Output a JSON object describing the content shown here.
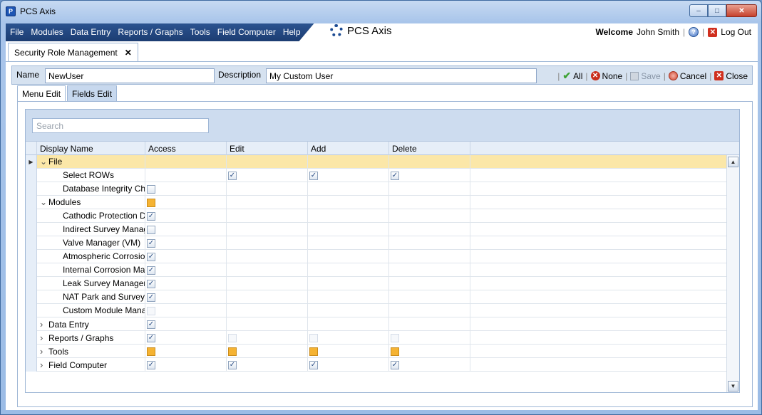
{
  "window": {
    "title": "PCS Axis"
  },
  "menu": {
    "items": [
      "File",
      "Modules",
      "Data Entry",
      "Reports / Graphs",
      "Tools",
      "Field Computer",
      "Help"
    ]
  },
  "brand": {
    "name": "PCS Axis"
  },
  "user": {
    "welcome": "Welcome",
    "name": "John Smith",
    "logout": "Log Out"
  },
  "doc_tab": {
    "label": "Security Role Management"
  },
  "form": {
    "name_label": "Name",
    "name_value": "NewUser",
    "description_label": "Description",
    "description_value": "My Custom User"
  },
  "actions": {
    "all": "All",
    "none": "None",
    "save": "Save",
    "cancel": "Cancel",
    "close": "Close"
  },
  "subtabs": [
    "Menu Edit",
    "Fields Edit"
  ],
  "grid": {
    "search_placeholder": "Search",
    "columns": [
      "Display Name",
      "Access",
      "Edit",
      "Add",
      "Delete"
    ],
    "rows": [
      {
        "name": "File",
        "level": 0,
        "expander": "expanded",
        "selected": true,
        "access": "",
        "edit": "",
        "add": "",
        "del": ""
      },
      {
        "name": "Select ROWs",
        "level": 1,
        "access": "",
        "edit": "checked",
        "add": "checked",
        "del": "checked"
      },
      {
        "name": "Database Integrity Che",
        "level": 1,
        "access": "unchecked",
        "edit": "",
        "add": "",
        "del": ""
      },
      {
        "name": "Modules",
        "level": 0,
        "expander": "expanded",
        "access": "partial",
        "edit": "",
        "add": "",
        "del": ""
      },
      {
        "name": "Cathodic Protection Da",
        "level": 1,
        "access": "checked",
        "edit": "",
        "add": "",
        "del": ""
      },
      {
        "name": "Indirect Survey Manag",
        "level": 1,
        "access": "unchecked",
        "edit": "",
        "add": "",
        "del": ""
      },
      {
        "name": "Valve Manager (VM)",
        "level": 1,
        "access": "checked",
        "edit": "",
        "add": "",
        "del": ""
      },
      {
        "name": "Atmospheric Corrosion",
        "level": 1,
        "access": "checked",
        "edit": "",
        "add": "",
        "del": ""
      },
      {
        "name": "Internal Corrosion Mar",
        "level": 1,
        "access": "checked",
        "edit": "",
        "add": "",
        "del": ""
      },
      {
        "name": "Leak Survey Manager (",
        "level": 1,
        "access": "checked",
        "edit": "",
        "add": "",
        "del": ""
      },
      {
        "name": "NAT Park and Survey M",
        "level": 1,
        "access": "checked",
        "edit": "",
        "add": "",
        "del": ""
      },
      {
        "name": "Custom Module Mana",
        "level": 1,
        "access": "faint",
        "edit": "",
        "add": "",
        "del": ""
      },
      {
        "name": "Data Entry",
        "level": 0,
        "expander": "collapsed",
        "access": "checked",
        "edit": "",
        "add": "",
        "del": ""
      },
      {
        "name": "Reports / Graphs",
        "level": 0,
        "expander": "collapsed",
        "access": "checked",
        "edit": "faint",
        "add": "faint",
        "del": "faint"
      },
      {
        "name": "Tools",
        "level": 0,
        "expander": "collapsed",
        "access": "partial",
        "edit": "partial",
        "add": "partial",
        "del": "partial"
      },
      {
        "name": "Field Computer",
        "level": 0,
        "expander": "collapsed",
        "access": "checked",
        "edit": "checked",
        "add": "checked",
        "del": "checked"
      }
    ]
  },
  "colors": {
    "accent": "#20447d",
    "selected_row": "#fbe7a8",
    "partial": "#f5b333"
  }
}
